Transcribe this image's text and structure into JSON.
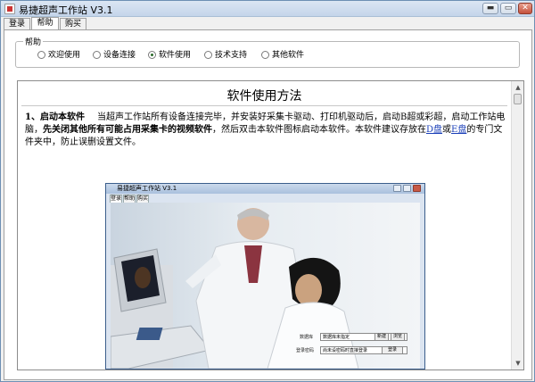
{
  "window": {
    "title": "易捷超声工作站 V3.1"
  },
  "window_buttons": {
    "minimize": "▬",
    "maximize": "▭",
    "close": "✕"
  },
  "tabs": [
    {
      "label": "登录",
      "active": false
    },
    {
      "label": "帮助",
      "active": true
    },
    {
      "label": "购买",
      "active": false
    }
  ],
  "help_group": {
    "label": "帮助",
    "options": [
      {
        "label": "欢迎使用",
        "checked": false
      },
      {
        "label": "设备连接",
        "checked": false
      },
      {
        "label": "软件使用",
        "checked": true
      },
      {
        "label": "技术支持",
        "checked": false
      },
      {
        "label": "其他软件",
        "checked": false
      }
    ]
  },
  "document": {
    "title": "软件使用方法",
    "section_heading": "1、启动本软件",
    "text_1": "当超声工作站所有设备连接完毕，并安装好采集卡驱动、打印机驱动后，启动B超或彩超，启动工作站电脑，",
    "text_bold": "先关闭其他所有可能占用采集卡的视频软件",
    "text_2": "，然后双击本软件图标启动本软件。本软件建议存放在",
    "link_d": "D盘",
    "text_or": "或",
    "link_e": "E盘",
    "text_3": "的专门文件夹中，防止误删设置文件。"
  },
  "scrollbar": {
    "up_arrow": "▲",
    "down_arrow": "▼"
  },
  "screenshot": {
    "title": "易捷超声工作站 V3.1",
    "tabs": [
      "登录",
      "帮助",
      "购买"
    ],
    "db_label": "数据库",
    "db_value": "数据库未指定",
    "btn_new": "新建",
    "btn_browse": "浏览",
    "pwd_label": "登录密码",
    "pwd_value": "尚未设密码时直接登录",
    "btn_login": "登录"
  }
}
